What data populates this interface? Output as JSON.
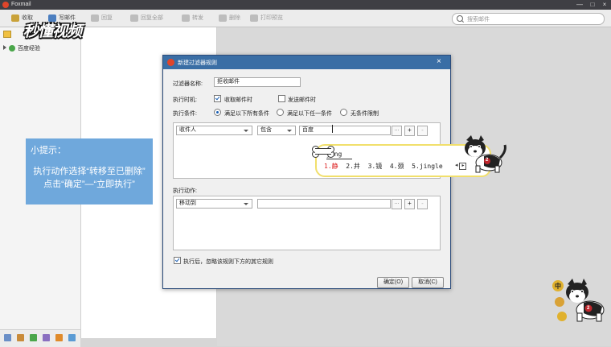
{
  "window": {
    "title": "Foxmail",
    "minimize": "—",
    "maximize": "□",
    "close": "×"
  },
  "toolbar": {
    "receive": "收取",
    "compose": "写邮件",
    "reply": "回复",
    "reply_all": "回复全部",
    "forward": "转发",
    "delete": "删除",
    "print_preview": "打印预览"
  },
  "search": {
    "placeholder": "搜索邮件"
  },
  "watermark": "秒懂视频",
  "sidebar": {
    "account": "百度经验"
  },
  "tip": {
    "title": "小提示：",
    "line1": "执行动作选择“转移至已删除”",
    "line2": "点击“确定”—“立即执行”"
  },
  "dialog": {
    "title": "新建过滤器规则",
    "name_label": "过滤器名称:",
    "name_value": "拒收邮件",
    "timing_label": "执行时机:",
    "timing_receive": "收取邮件时",
    "timing_send": "发送邮件时",
    "cond_label": "执行条件:",
    "cond_all": "满足以下所有条件",
    "cond_any": "满足以下任一条件",
    "cond_none": "无条件限制",
    "cond_field": "收件人",
    "cond_op": "包含",
    "cond_value": "百度",
    "ellipsis": "···",
    "plus": "+",
    "minus": "-",
    "action_label": "执行动作:",
    "action_select": "移动到",
    "after_label": "执行后，忽略该规则下方的其它规则",
    "ok": "确定(O)",
    "cancel": "取消(C)"
  },
  "ime": {
    "code": "jing",
    "c1": "1.静",
    "c2": "2.井",
    "c3": "3.镜",
    "c4": "4.颈",
    "c5": "5.jingle",
    "prev": "◂",
    "next": "▸"
  },
  "colors": {
    "dialog_header": "#3a6ea5",
    "tip_bg": "#6fa8dc",
    "ime_border": "#f1df6b"
  },
  "deco": {
    "badge1": "中",
    "badge2": "2"
  }
}
